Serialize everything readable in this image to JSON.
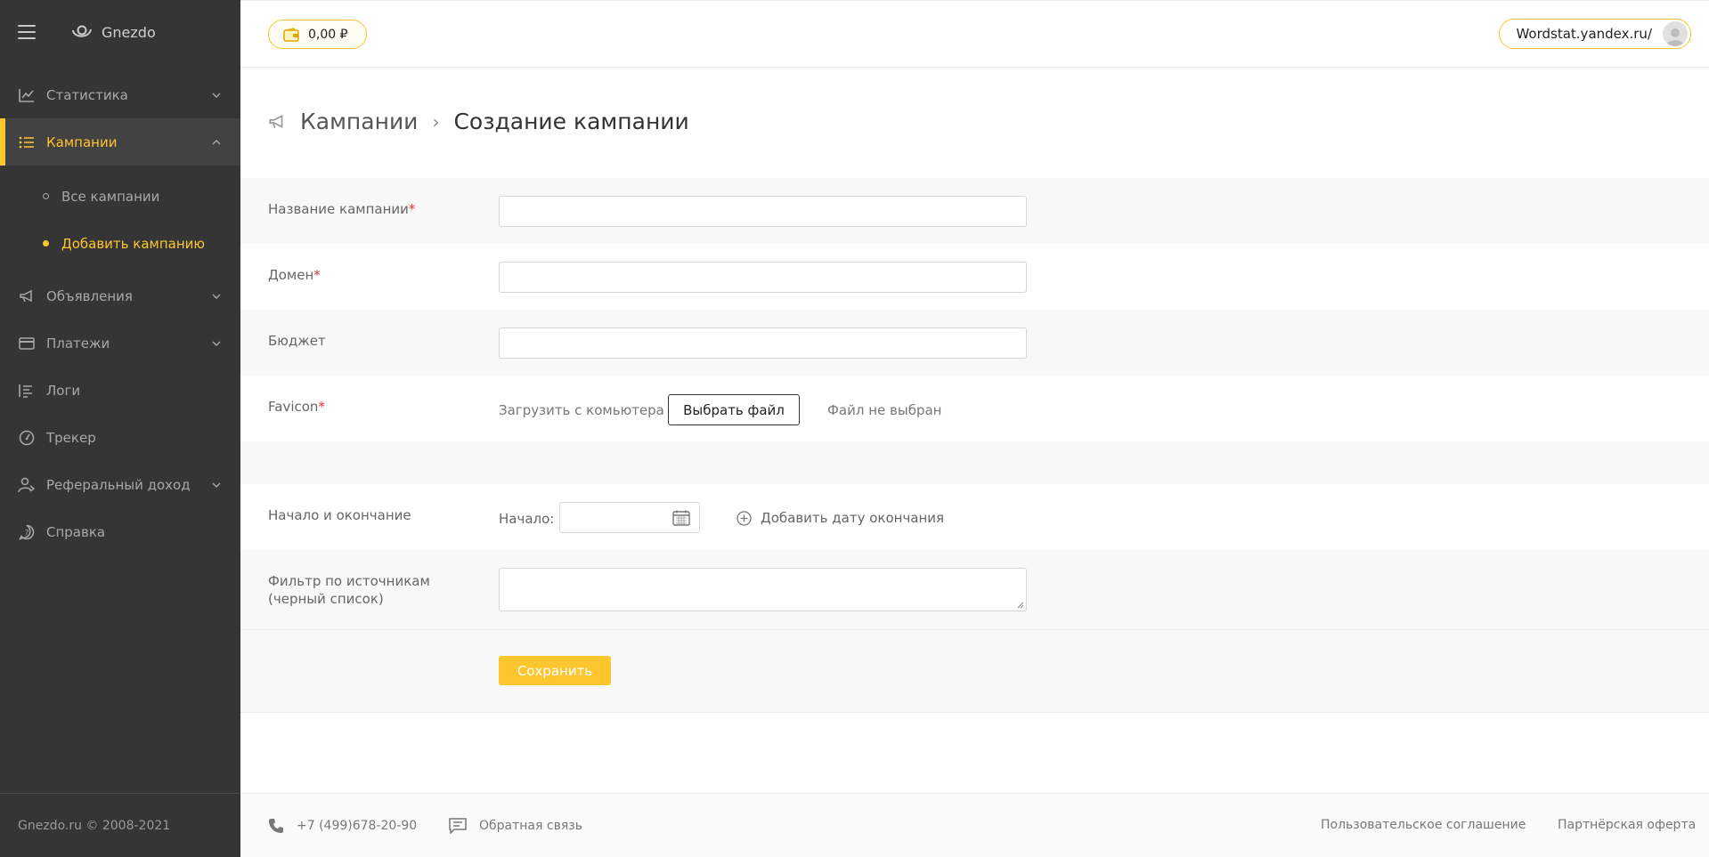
{
  "sidebar": {
    "logo": "Gnezdo",
    "items": [
      {
        "label": "Статистика"
      },
      {
        "label": "Кампании"
      },
      {
        "label": "Объявления"
      },
      {
        "label": "Платежи"
      },
      {
        "label": "Логи"
      },
      {
        "label": "Трекер"
      },
      {
        "label": "Реферальный доход"
      },
      {
        "label": "Справка"
      }
    ],
    "subitems": [
      {
        "label": "Все кампании"
      },
      {
        "label": "Добавить кампанию"
      }
    ],
    "footer": "Gnezdo.ru © 2008-2021"
  },
  "topbar": {
    "balance": "0,00 ₽",
    "account": "Wordstat.yandex.ru/"
  },
  "breadcrumb": {
    "parent": "Кампании",
    "separator": "›",
    "current": "Создание кампании"
  },
  "form": {
    "name_label": "Название кампании",
    "domain_label": "Домен",
    "budget_label": "Бюджет",
    "favicon_label": "Favicon",
    "required_mark": "*",
    "upload_label": "Загрузить с комьютера",
    "file_button": "Выбрать файл",
    "file_status": "Файл не выбран",
    "dates_label": "Начало и окончание",
    "start_label": "Начало:",
    "add_end_date": "Добавить дату окончания",
    "filter_label": "Фильтр по источникам (черный список)",
    "save_button": "Сохранить"
  },
  "footer": {
    "phone": "+7 (499)678-20-90",
    "feedback": "Обратная связь",
    "agreement": "Пользовательское соглашение",
    "offer": "Партнёрская оферта"
  },
  "colors": {
    "accent": "#fdc52e",
    "sidebar_bg": "#353535",
    "required": "#e5333e"
  }
}
